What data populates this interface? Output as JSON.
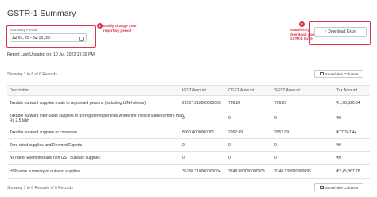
{
  "page": {
    "title": "GSTR-1 Summary",
    "summary_period_label": "Summary Period",
    "summary_period_value": "Jul 01, 23 - Jul 31, 23",
    "download_button": "Download Excel",
    "last_updated": "Report Last Updated on: 10 Jul, 2023 19:39 PM"
  },
  "annotations": {
    "badge1": "1",
    "note1": "Easily change your reporting period",
    "badge2": "2",
    "note2": "Seamlessly download your GSTR-1 Excel"
  },
  "records": {
    "prefix": "Showing ",
    "start": "1",
    "mid": " to ",
    "end": "6",
    "suffix": " of 6 Records",
    "bottom_text": "Showing 1 to 6 Records of 6 Records",
    "show_hide_button": "Show/Hide Columns"
  },
  "table": {
    "headers": [
      "Description",
      "IGST Amount",
      "CGST Amount",
      "SGST Amount",
      "Tax Amount"
    ],
    "rows": [
      [
        "Taxable outward supplies made to registered persons (including UIN-holders)",
        "28757.910000000003",
        "796.89",
        "796.87",
        "₹1,68,620.34"
      ],
      [
        "Taxable outward inter-State supplies to un-registered persons where the invoice value is more than Rs 2.5 lakh",
        "0",
        "0",
        "0",
        "₹0"
      ],
      [
        "Taxable outward supplies to consumer",
        "8000.4000000001",
        "2952.09",
        "2952.09",
        "₹77,247.44"
      ],
      [
        "Zero rated supplies and Deemed Exports",
        "0",
        "0",
        "0",
        "₹0"
      ],
      [
        "Nil rated, Exempted and non GST outward supplies",
        "0",
        "0",
        "0",
        "₹0"
      ],
      [
        "HSN-wise summary of outward supplies",
        "36758.310000000004",
        "3748.980000000005",
        "3748.939999999996",
        "₹2,45,867.78"
      ]
    ]
  },
  "colors": {
    "accent": "#d9344a",
    "link": "#2f6fd6"
  }
}
